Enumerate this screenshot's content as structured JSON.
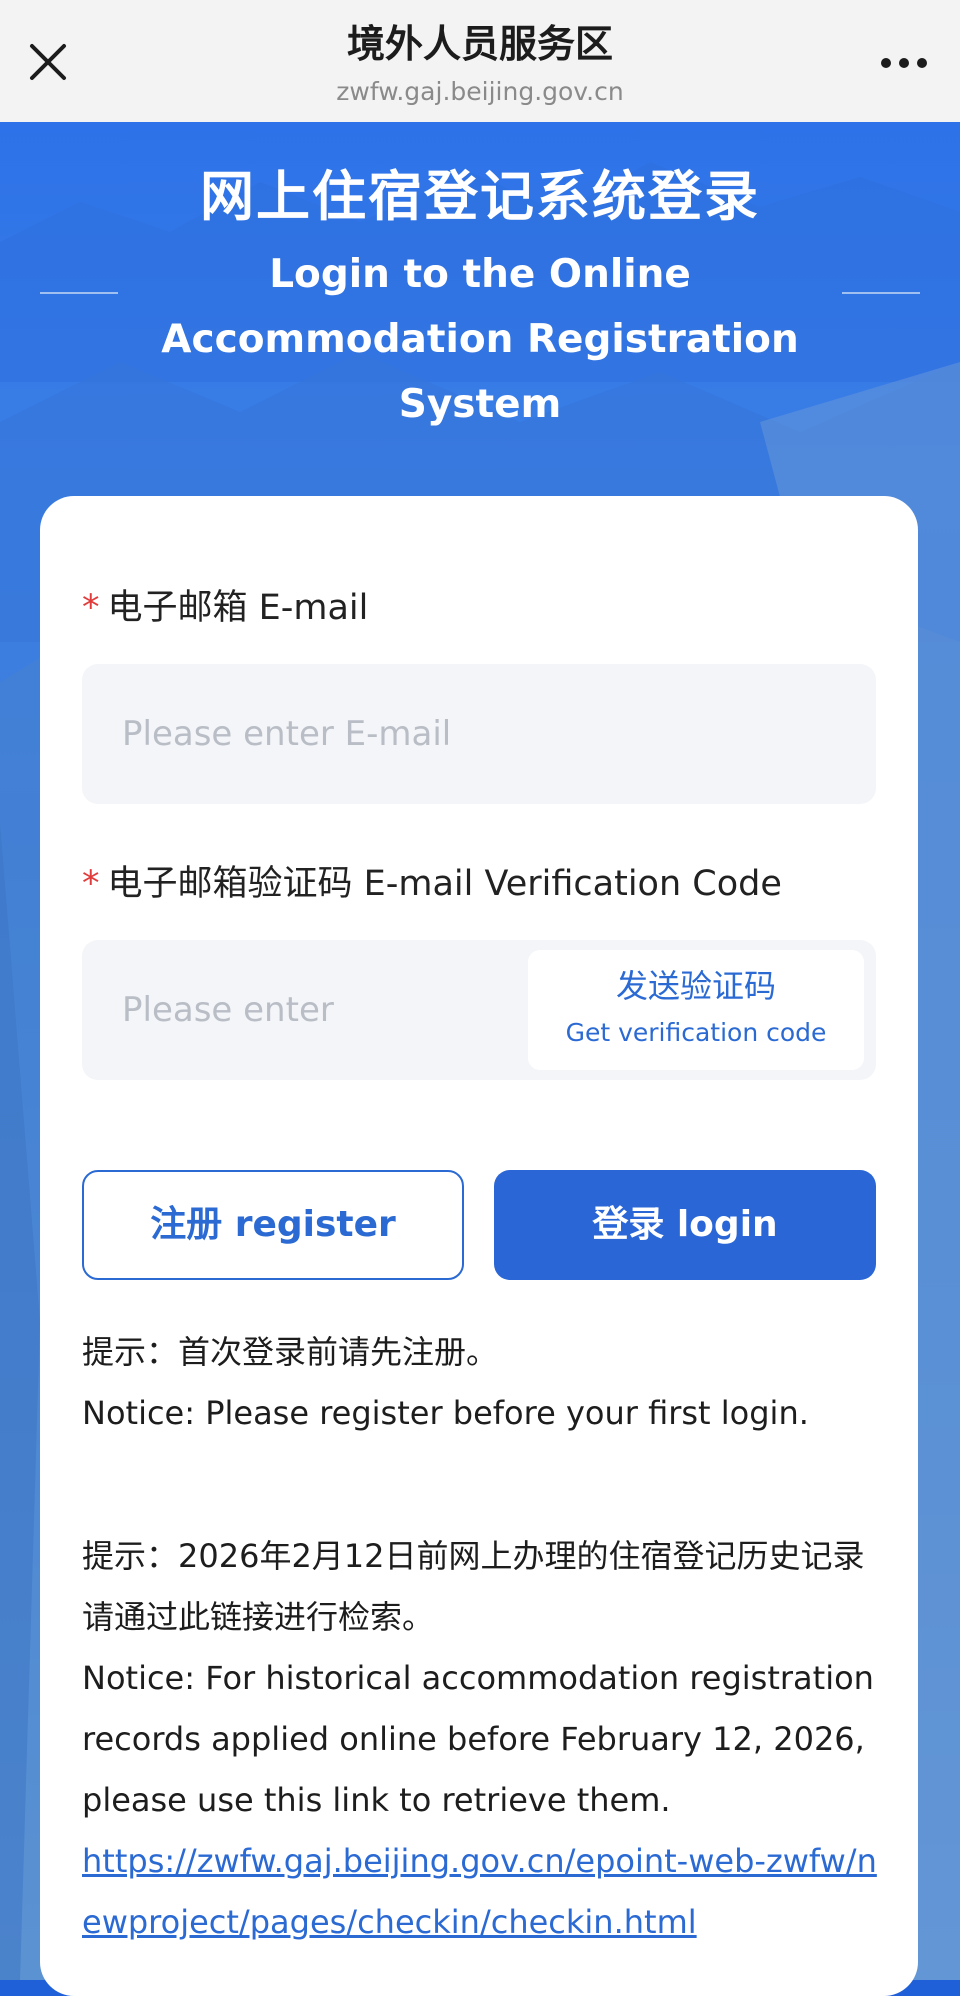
{
  "topbar": {
    "title": "境外人员服务区",
    "url": "zwfw.gaj.beijing.gov.cn"
  },
  "hero": {
    "title_cn": "网上住宿登记系统登录",
    "title_en": "Login to the Online Accommodation Registration System"
  },
  "form": {
    "email_label": "电子邮箱 E-mail",
    "email_placeholder": "Please enter E-mail",
    "code_label": "电子邮箱验证码 E-mail Verification Code",
    "code_placeholder": "Please enter",
    "send_code_cn": "发送验证码",
    "send_code_en": "Get verification code",
    "required_mark": "*",
    "register_label": "注册 register",
    "login_label": "登录 login"
  },
  "notices": {
    "notice1_cn": "提示：首次登录前请先注册。",
    "notice1_en": "Notice: Please register before your first login.",
    "notice2_cn": "提示：2026年2月12日前网上办理的住宿登记历史记录请通过此链接进行检索。",
    "notice2_en": "Notice: For historical accommodation registration records applied online before February 12, 2026, please use this link to retrieve them.",
    "link": "https://zwfw.gaj.beijing.gov.cn/epoint-web-zwfw/newproject/pages/checkin/checkin.html"
  },
  "colors": {
    "primary": "#2a66d6",
    "required": "#e23b3b",
    "hero_bg": "#2d72e8"
  }
}
